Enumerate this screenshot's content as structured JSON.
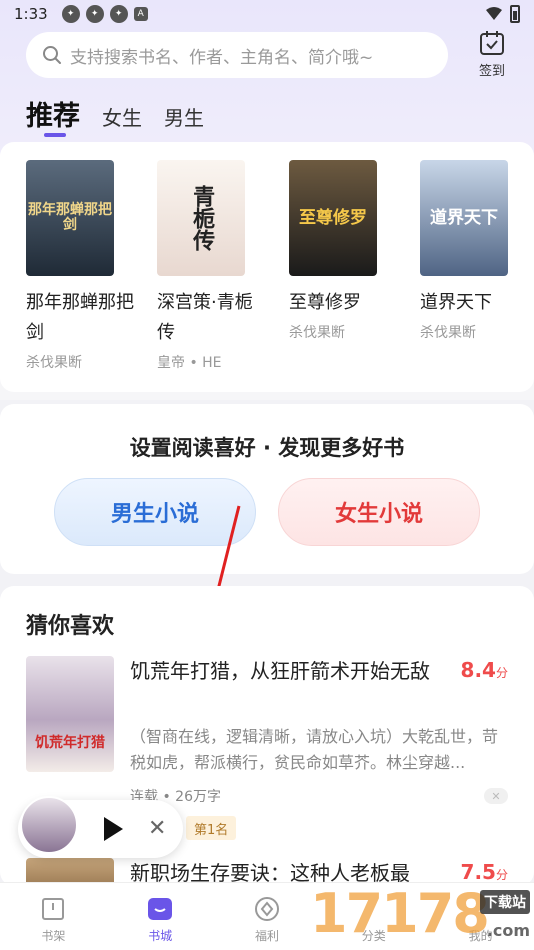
{
  "status_bar": {
    "time": "1:33",
    "notif_glyph": "A"
  },
  "search": {
    "placeholder": "支持搜索书名、作者、主角名、简介哦~"
  },
  "checkin": {
    "label": "签到"
  },
  "tabs": [
    {
      "label": "推荐",
      "active": true
    },
    {
      "label": "女生",
      "active": false
    },
    {
      "label": "男生",
      "active": false
    }
  ],
  "recommended": [
    {
      "title": "那年那蝉那把剑",
      "author": "杀伐果断",
      "cover_text": "那年那蝉那把剑",
      "cover_color": "#3b4a5a"
    },
    {
      "title": "深宫策·青栀传",
      "author": "皇帝 • HE",
      "cover_text": "青栀传",
      "cover_color": "#f4ece6"
    },
    {
      "title": "至尊修罗",
      "author": "杀伐果断",
      "cover_text": "至尊修罗",
      "cover_color": "#2a2a2a"
    },
    {
      "title": "道界天下",
      "author": "杀伐果断",
      "cover_text": "道界天下",
      "cover_color": "#8fa6c4"
    }
  ],
  "preference": {
    "title": "设置阅读喜好 · 发现更多好书",
    "male_label": "男生小说",
    "female_label": "女生小说"
  },
  "guess": {
    "title": "猜你喜欢",
    "items": [
      {
        "title": "饥荒年打猎，从狂肝箭术开始无敌",
        "score": "8.4",
        "score_unit": "分",
        "desc": "（智商在线，逻辑清晰，请放心入坑）大乾乱世，苛税如虎，帮派横行，贫民命如草芥。林尘穿越...",
        "meta": "连载 • 26万字",
        "rank": "第1名",
        "cover_text": "饥荒年打猎"
      },
      {
        "title": "新职场生存要诀：这种人老板最",
        "score": "7.5",
        "score_unit": "分"
      }
    ]
  },
  "player": {
    "close_glyph": "✕"
  },
  "bottom_nav": [
    {
      "label": "书架",
      "icon": "bookshelf-icon",
      "active": false
    },
    {
      "label": "书城",
      "icon": "bookstore-icon",
      "active": true
    },
    {
      "label": "福利",
      "icon": "welfare-icon",
      "active": false
    },
    {
      "label": "分类",
      "icon": "category-icon",
      "active": false
    },
    {
      "label": "我的",
      "icon": "profile-icon",
      "active": false
    }
  ],
  "watermark": {
    "text": "17178",
    "sub": "下载站",
    "com": ".com"
  },
  "colors": {
    "accent": "#6a55e8",
    "score": "#ef4b4b",
    "male": "#2a6dd6",
    "female": "#e23a3a"
  }
}
